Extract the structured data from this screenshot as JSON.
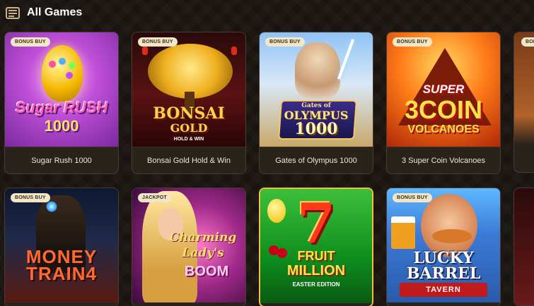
{
  "header": {
    "title": "All Games",
    "icon": "slot-machine-icon"
  },
  "games": [
    {
      "name": "Sugar Rush 1000",
      "badge": "BONUS BUY",
      "art": [
        "Sugar RUSH",
        "1000"
      ]
    },
    {
      "name": "Bonsai Gold Hold & Win",
      "badge": "BONUS BUY",
      "art": [
        "BONSAI",
        "GOLD",
        "HOLD & WIN"
      ]
    },
    {
      "name": "Gates of Olympus 1000",
      "badge": "BONUS BUY",
      "art": [
        "Gates of",
        "OLYMPUS",
        "1000"
      ]
    },
    {
      "name": "3 Super Coin Volcanoes",
      "badge": "BONUS BUY",
      "art": [
        "SUPER",
        "3COIN",
        "VOLCANOES"
      ]
    },
    {
      "name": "",
      "badge": "BONUS BUY",
      "art": [
        "MONEY",
        "TRAIN4"
      ]
    },
    {
      "name": "",
      "badge": "JACKPOT",
      "art": [
        "Charming",
        "Lady's",
        "BOOM"
      ]
    },
    {
      "name": "",
      "badge": "",
      "art": [
        "FRUIT",
        "MILLION",
        "EASTER EDITION"
      ]
    },
    {
      "name": "",
      "badge": "BONUS BUY",
      "art": [
        "LUCKY",
        "BARREL",
        "TAVERN"
      ]
    }
  ],
  "partial": {
    "badge": "BONUS"
  }
}
